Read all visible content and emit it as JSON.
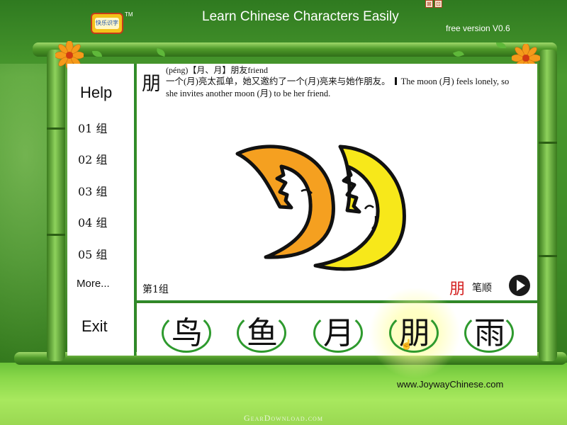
{
  "app": {
    "title": "Learn Chinese Characters Easily",
    "version": "free version V0.6",
    "logo_text": "快乐识字",
    "tm": "TM",
    "website": "www.JoywayChinese.com",
    "watermark": "GearDownload.com"
  },
  "window_controls": [
    {
      "name": "minimize-icon",
      "glyph": "⊠"
    },
    {
      "name": "close-icon",
      "glyph": "⊡"
    }
  ],
  "sidebar": {
    "help": "Help",
    "groups": [
      "01 组",
      "02 组",
      "03 组",
      "04 组",
      "05 组"
    ],
    "more": "More...",
    "exit": "Exit"
  },
  "lesson": {
    "character": "朋",
    "pinyin_line": "(péng)【月、月】朋友friend",
    "story_cn": "一个(月)亮太孤单，她又邀约了一个(月)亮来与她作朋友。",
    "story_en": "The moon (月) feels lonely, so she invites another moon (月) to be her friend.",
    "group_label": "第1组",
    "stroke_char": "朋",
    "stroke_label": "笔顺"
  },
  "characters": [
    "鸟",
    "鱼",
    "月",
    "朋",
    "雨"
  ],
  "selected_index": 3,
  "colors": {
    "frame_green": "#2e8a2a",
    "moon_orange": "#f5a020",
    "moon_yellow": "#f7e81a",
    "stroke_red": "#d42020"
  }
}
